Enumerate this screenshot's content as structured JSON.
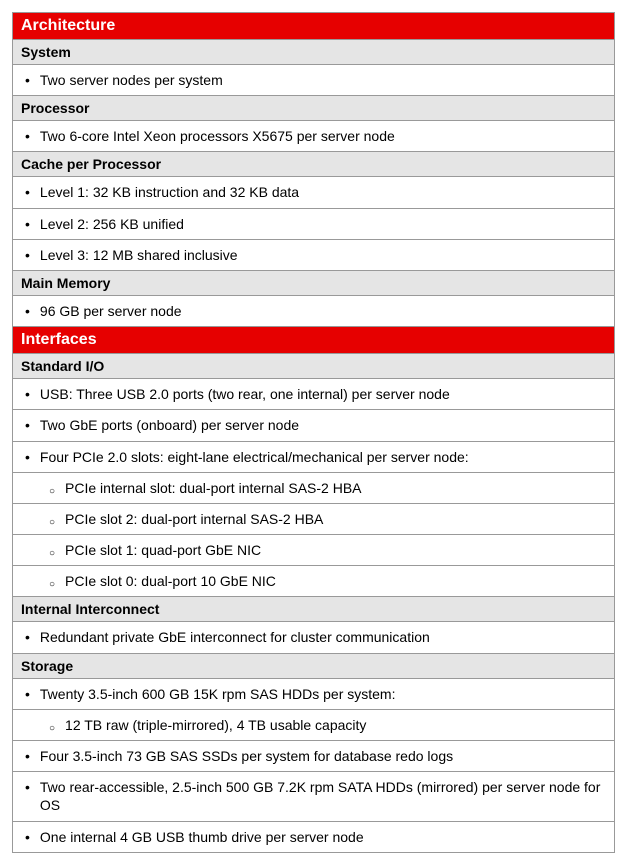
{
  "sections": [
    {
      "title": "Architecture",
      "subsections": [
        {
          "title": "System",
          "items": [
            {
              "text": "Two server nodes per system",
              "indent": 0
            }
          ]
        },
        {
          "title": "Processor",
          "items": [
            {
              "text": "Two 6-core Intel Xeon processors X5675 per server node",
              "indent": 0
            }
          ]
        },
        {
          "title": "Cache per Processor",
          "items": [
            {
              "text": "Level 1: 32 KB instruction and 32 KB data",
              "indent": 0
            },
            {
              "text": "Level 2: 256 KB unified",
              "indent": 0
            },
            {
              "text": "Level 3: 12 MB shared inclusive",
              "indent": 0
            }
          ]
        },
        {
          "title": "Main Memory",
          "items": [
            {
              "text": "96 GB per server node",
              "indent": 0
            }
          ]
        }
      ]
    },
    {
      "title": "Interfaces",
      "subsections": [
        {
          "title": "Standard I/O",
          "items": [
            {
              "text": "USB: Three USB 2.0 ports (two rear, one internal) per server node",
              "indent": 0
            },
            {
              "text": "Two GbE ports (onboard) per server node",
              "indent": 0
            },
            {
              "text": "Four PCIe 2.0 slots: eight-lane electrical/mechanical per server node:",
              "indent": 0
            },
            {
              "text": "PCIe internal slot: dual-port internal SAS-2 HBA",
              "indent": 1
            },
            {
              "text": "PCIe slot 2: dual-port internal SAS-2 HBA",
              "indent": 1
            },
            {
              "text": "PCIe slot 1: quad-port GbE NIC",
              "indent": 1
            },
            {
              "text": "PCIe slot 0: dual-port 10 GbE NIC",
              "indent": 1
            }
          ]
        },
        {
          "title": "Internal Interconnect",
          "items": [
            {
              "text": "Redundant private GbE interconnect for cluster communication",
              "indent": 0
            }
          ]
        },
        {
          "title": "Storage",
          "items": [
            {
              "text": "Twenty 3.5-inch 600 GB 15K rpm SAS HDDs per system:",
              "indent": 0
            },
            {
              "text": "12 TB raw (triple-mirrored), 4 TB usable capacity",
              "indent": 1
            },
            {
              "text": "Four 3.5-inch 73 GB SAS SSDs per system for database redo logs",
              "indent": 0
            },
            {
              "text": "Two rear-accessible, 2.5-inch 500 GB 7.2K rpm SATA HDDs (mirrored) per server node for OS",
              "indent": 0
            },
            {
              "text": "One internal 4 GB USB thumb drive per server node",
              "indent": 0
            }
          ]
        }
      ]
    }
  ]
}
